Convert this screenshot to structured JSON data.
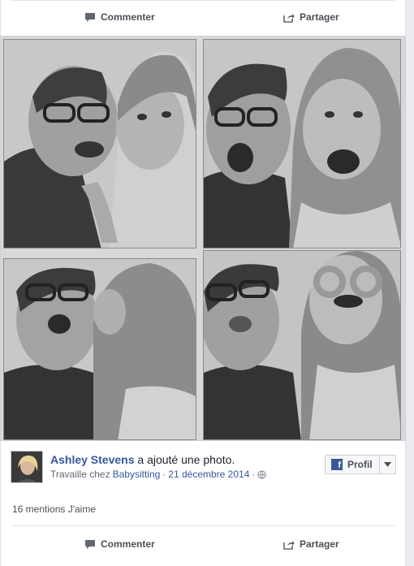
{
  "actions": {
    "comment": "Commenter",
    "share": "Partager"
  },
  "post": {
    "author": "Ashley Stevens",
    "action_text": "a ajouté une photo.",
    "meta_prefix": "Travaille chez",
    "workplace": "Babysitting",
    "date": "21 décembre 2014",
    "meta_sep": "·",
    "privacy_icon": "globe-icon"
  },
  "profile_button": {
    "icon": "facebook-icon",
    "label": "Profil"
  },
  "likes_text": "16 mentions J'aime"
}
